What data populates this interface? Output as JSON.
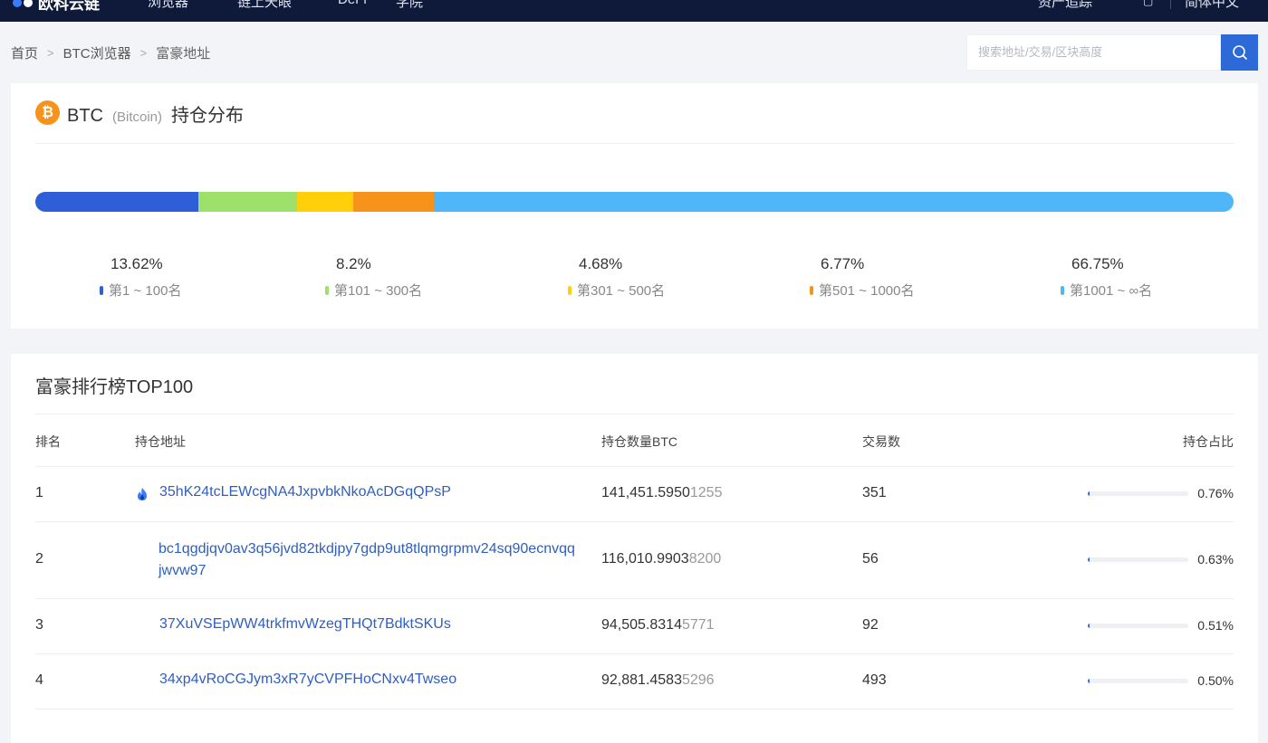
{
  "topbar": {
    "brand": "欧科云链",
    "nav": [
      "浏览器",
      "链上天眼",
      "DeFi",
      "学院"
    ],
    "right": [
      "资产追踪",
      "简体中文"
    ]
  },
  "breadcrumb": [
    "首页",
    "BTC浏览器",
    "富豪地址"
  ],
  "search": {
    "placeholder": "搜索地址/交易/区块高度"
  },
  "coin": {
    "symbol": "BTC",
    "name": "(Bitcoin)",
    "title": "持仓分布",
    "icon_glyph": "₿"
  },
  "distribution": [
    {
      "percent": "13.62%",
      "fraction": 0.1362,
      "label": "第1 ~ 100名",
      "color": "#2f5fd8"
    },
    {
      "percent": "8.2%",
      "fraction": 0.082,
      "label": "第101 ~ 300名",
      "color": "#9de06a"
    },
    {
      "percent": "4.68%",
      "fraction": 0.0468,
      "label": "第301 ~ 500名",
      "color": "#ffcf0a"
    },
    {
      "percent": "6.77%",
      "fraction": 0.0677,
      "label": "第501 ~ 1000名",
      "color": "#f7931a"
    },
    {
      "percent": "66.75%",
      "fraction": 0.6675,
      "label": "第1001 ~ ∞名",
      "color": "#4fb7f7"
    }
  ],
  "ranking": {
    "title": "富豪排行榜TOP100",
    "columns": [
      "排名",
      "持仓地址",
      "持仓数量BTC",
      "交易数",
      "持仓占比"
    ],
    "rows": [
      {
        "rank": "1",
        "address": "35hK24tcLEWcgNA4JxpvbkNkoAcDGqQPsP",
        "amount_main": "141,451.5950",
        "amount_dim": "1255",
        "tx": "351",
        "share": "0.76%",
        "share_fraction": 0.0076,
        "icon": "flame-icon"
      },
      {
        "rank": "2",
        "address": "bc1qgdjqv0av3q56jvd82tkdjpy7gdp9ut8tlqmgrpmv24sq90ecnvqqjwvw97",
        "amount_main": "116,010.9903",
        "amount_dim": "8200",
        "tx": "56",
        "share": "0.63%",
        "share_fraction": 0.0063,
        "icon": ""
      },
      {
        "rank": "3",
        "address": "37XuVSEpWW4trkfmvWzegTHQt7BdktSKUs",
        "amount_main": "94,505.8314",
        "amount_dim": "5771",
        "tx": "92",
        "share": "0.51%",
        "share_fraction": 0.0051,
        "icon": ""
      },
      {
        "rank": "4",
        "address": "34xp4vRoCGJym3xR7yCVPFHoCNxv4Twseo",
        "amount_main": "92,881.4583",
        "amount_dim": "5296",
        "tx": "493",
        "share": "0.50%",
        "share_fraction": 0.005,
        "icon": ""
      }
    ]
  }
}
